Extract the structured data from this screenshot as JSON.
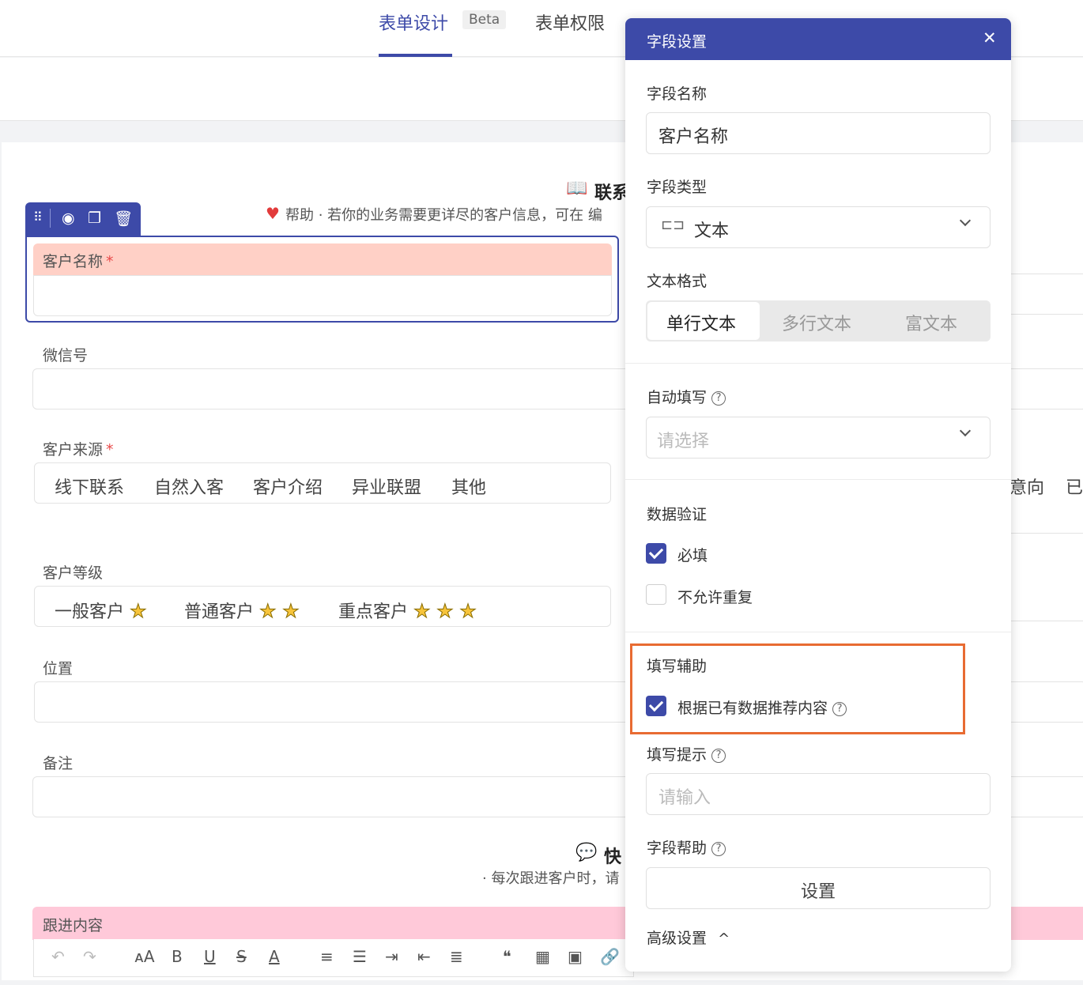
{
  "header": {
    "tabs": [
      {
        "label": "表单设计"
      },
      {
        "label": "表单权限"
      }
    ],
    "beta": "Beta"
  },
  "form": {
    "section1": {
      "title": "联系",
      "help": "帮助 · 若你的业务需要更详尽的客户信息，可在 编"
    },
    "fields": {
      "customer_name": {
        "label": "客户名称",
        "required": "*"
      },
      "wechat": {
        "label": "微信号"
      },
      "source": {
        "label": "客户来源",
        "required": "*",
        "options": [
          "线下联系",
          "自然入客",
          "客户介绍",
          "异业联盟",
          "其他"
        ],
        "overflow": [
          "意向",
          "已"
        ]
      },
      "level": {
        "label": "客户等级",
        "options": [
          {
            "text": "一般客户",
            "stars": "★"
          },
          {
            "text": "普通客户",
            "stars": "★ ★"
          },
          {
            "text": "重点客户",
            "stars": "★ ★ ★"
          }
        ]
      },
      "location": {
        "label": "位置"
      },
      "remark": {
        "label": "备注"
      },
      "followup": {
        "label": "跟进内容"
      }
    },
    "section2": {
      "title": "快",
      "desc": "· 每次跟进客户时，请"
    },
    "editor_tools": [
      "↶",
      "↷",
      "ᴀA",
      "B",
      "U",
      "S",
      "A",
      "≡",
      "☰",
      "⇥",
      "⇤",
      "≣",
      "❝",
      "▦",
      "▣",
      "🔗"
    ]
  },
  "panel": {
    "title": "字段设置",
    "close": "✕",
    "field_name": {
      "label": "字段名称",
      "value": "客户名称"
    },
    "field_type": {
      "label": "字段类型",
      "value": "文本",
      "icon": "⊏⊐"
    },
    "text_format": {
      "label": "文本格式",
      "options": [
        "单行文本",
        "多行文本",
        "富文本"
      ],
      "selected": "单行文本"
    },
    "autofill": {
      "label": "自动填写",
      "placeholder": "请选择"
    },
    "validation": {
      "label": "数据验证",
      "required": "必填",
      "unique": "不允许重复"
    },
    "assist": {
      "label": "填写辅助",
      "recommend": "根据已有数据推荐内容"
    },
    "hint": {
      "label": "填写提示",
      "placeholder": "请输入"
    },
    "help": {
      "label": "字段帮助",
      "button": "设置"
    },
    "advanced": {
      "label": "高级设置",
      "caret": "^"
    },
    "help_mark": "?"
  }
}
